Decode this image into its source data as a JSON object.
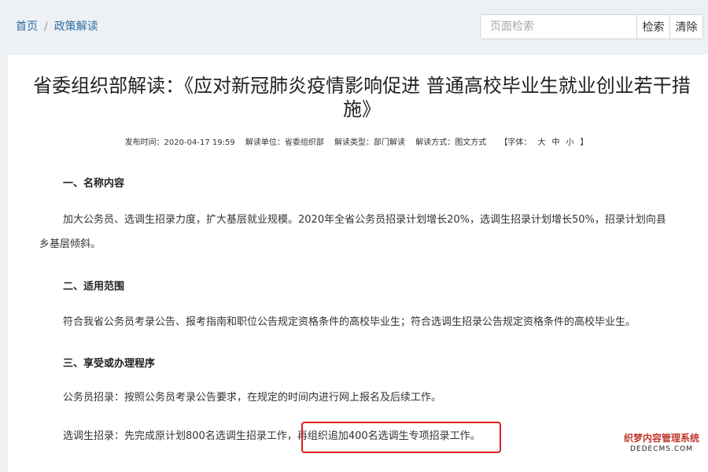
{
  "breadcrumb": {
    "home": "首页",
    "separator": "/",
    "current": "政策解读"
  },
  "search": {
    "placeholder": "页面检索",
    "search_label": "检索",
    "clear_label": "清除"
  },
  "article": {
    "title": "省委组织部解读：《应对新冠肺炎疫情影响促进 普通高校毕业生就业创业若干措施》",
    "meta": {
      "publish": "发布时间：2020-04-17 19:59",
      "unit": "解读单位：省委组织部",
      "type": "解读类型：部门解读",
      "mode": "解读方式：图文方式",
      "font_prefix": "【字体：",
      "font_large": "大",
      "font_medium": "中",
      "font_small": "小",
      "font_suffix": "】"
    },
    "sections": [
      {
        "heading": "一、名称内容"
      },
      {
        "heading": "二、适用范围"
      },
      {
        "heading": "三、享受或办理程序"
      }
    ],
    "para1": "加大公务员、选调生招录力度，扩大基层就业规模。2020年全省公务员招录计划增长20%，选调生招录计划增长50%，招录计划向县乡基层倾斜。",
    "para2": "符合我省公务员考录公告、报考指南和职位公告规定资格条件的高校毕业生；符合选调生招录公告规定资格条件的高校毕业生。",
    "para3": "公务员招录：按照公务员考录公告要求，在规定的时间内进行网上报名及后续工作。",
    "para4": "选调生招录：先完成原计划800名选调生招录工作，再组织追加400名选调生专项招录工作。"
  },
  "watermark": {
    "line1": "织梦内容管理系统",
    "line2": "DEDECMS.COM"
  },
  "colors": {
    "link": "#2e6da4",
    "highlight": "#e02020",
    "background": "#eef1f4"
  }
}
